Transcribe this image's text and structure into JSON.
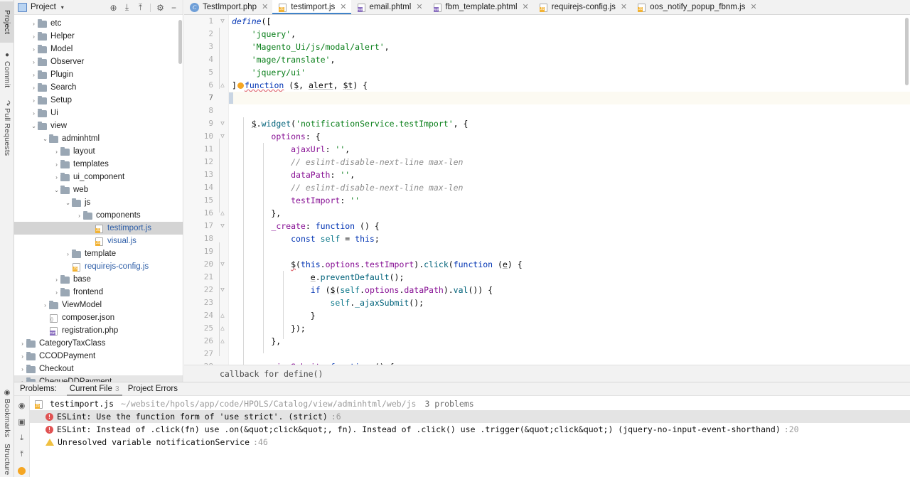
{
  "left_toolbar": {
    "top_items": [
      {
        "label": "Project",
        "icon": "project-icon",
        "active": true
      },
      {
        "label": "Commit",
        "icon": "commit-icon",
        "active": false
      },
      {
        "label": "Pull Requests",
        "icon": "pull-requests-icon",
        "active": false
      }
    ],
    "bottom_items": [
      {
        "label": "Bookmarks",
        "icon": "bookmarks-icon",
        "active": false
      },
      {
        "label": "Structure",
        "icon": "structure-icon",
        "active": false
      }
    ]
  },
  "project_panel": {
    "title": "Project",
    "caret": "▾",
    "tools": [
      {
        "name": "locate-icon",
        "glyph": "⊕"
      },
      {
        "name": "expand-all-icon",
        "glyph": "⤓"
      },
      {
        "name": "collapse-all-icon",
        "glyph": "⤒"
      },
      {
        "name": "settings-gear-icon",
        "glyph": "⚙"
      },
      {
        "name": "hide-panel-icon",
        "glyph": "−"
      }
    ],
    "tree": [
      {
        "label": "etc",
        "indent": 1,
        "arrow": "›",
        "icon": "folder",
        "selected": false
      },
      {
        "label": "Helper",
        "indent": 1,
        "arrow": "›",
        "icon": "folder",
        "selected": false
      },
      {
        "label": "Model",
        "indent": 1,
        "arrow": "›",
        "icon": "folder",
        "selected": false
      },
      {
        "label": "Observer",
        "indent": 1,
        "arrow": "›",
        "icon": "folder",
        "selected": false
      },
      {
        "label": "Plugin",
        "indent": 1,
        "arrow": "›",
        "icon": "folder",
        "selected": false
      },
      {
        "label": "Search",
        "indent": 1,
        "arrow": "›",
        "icon": "folder",
        "selected": false
      },
      {
        "label": "Setup",
        "indent": 1,
        "arrow": "›",
        "icon": "folder",
        "selected": false
      },
      {
        "label": "Ui",
        "indent": 1,
        "arrow": "›",
        "icon": "folder",
        "selected": false
      },
      {
        "label": "view",
        "indent": 1,
        "arrow": "⌄",
        "icon": "folder",
        "selected": false
      },
      {
        "label": "adminhtml",
        "indent": 2,
        "arrow": "⌄",
        "icon": "folder",
        "selected": false
      },
      {
        "label": "layout",
        "indent": 3,
        "arrow": "›",
        "icon": "folder",
        "selected": false
      },
      {
        "label": "templates",
        "indent": 3,
        "arrow": "›",
        "icon": "folder",
        "selected": false
      },
      {
        "label": "ui_component",
        "indent": 3,
        "arrow": "›",
        "icon": "folder",
        "selected": false
      },
      {
        "label": "web",
        "indent": 3,
        "arrow": "⌄",
        "icon": "folder",
        "selected": false
      },
      {
        "label": "js",
        "indent": 4,
        "arrow": "⌄",
        "icon": "folder",
        "selected": false
      },
      {
        "label": "components",
        "indent": 5,
        "arrow": "›",
        "icon": "folder",
        "selected": false
      },
      {
        "label": "testimport.js",
        "indent": 6,
        "arrow": "",
        "icon": "js",
        "selected": true
      },
      {
        "label": "visual.js",
        "indent": 6,
        "arrow": "",
        "icon": "js",
        "selected": false
      },
      {
        "label": "template",
        "indent": 4,
        "arrow": "›",
        "icon": "folder",
        "selected": false
      },
      {
        "label": "requirejs-config.js",
        "indent": 4,
        "arrow": "",
        "icon": "js",
        "selected": false
      },
      {
        "label": "base",
        "indent": 3,
        "arrow": "›",
        "icon": "folder",
        "selected": false
      },
      {
        "label": "frontend",
        "indent": 3,
        "arrow": "›",
        "icon": "folder",
        "selected": false
      },
      {
        "label": "ViewModel",
        "indent": 2,
        "arrow": "›",
        "icon": "folder",
        "selected": false
      },
      {
        "label": "composer.json",
        "indent": 2,
        "arrow": "",
        "icon": "json",
        "selected": false
      },
      {
        "label": "registration.php",
        "indent": 2,
        "arrow": "",
        "icon": "php",
        "selected": false
      },
      {
        "label": "CategoryTaxClass",
        "indent": 0,
        "arrow": "›",
        "icon": "folder",
        "selected": false
      },
      {
        "label": "CCODPayment",
        "indent": 0,
        "arrow": "›",
        "icon": "folder",
        "selected": false
      },
      {
        "label": "Checkout",
        "indent": 0,
        "arrow": "›",
        "icon": "folder",
        "selected": false
      },
      {
        "label": "ChequeDDPayment",
        "indent": 0,
        "arrow": "›",
        "icon": "folder",
        "selected": false
      }
    ]
  },
  "tabs": [
    {
      "label": "TestImport.php",
      "icon": "php-class-icon",
      "active": false
    },
    {
      "label": "testimport.js",
      "icon": "js-file-icon",
      "active": true
    },
    {
      "label": "email.phtml",
      "icon": "phtml-file-icon",
      "active": false
    },
    {
      "label": "fbm_template.phtml",
      "icon": "phtml-file-icon",
      "active": false
    },
    {
      "label": "requirejs-config.js",
      "icon": "js-file-icon",
      "active": false
    },
    {
      "label": "oos_notify_popup_fbnm.js",
      "icon": "js-file-icon",
      "active": false
    }
  ],
  "editor": {
    "hint": "callback for define()",
    "lines": [
      {
        "n": 1,
        "fold": "▽",
        "current": false,
        "tokens": [
          {
            "t": "define",
            "c": "kwi"
          },
          {
            "t": "([",
            "c": "plain"
          }
        ]
      },
      {
        "n": 2,
        "fold": "",
        "current": false,
        "tokens": [
          {
            "t": "    ",
            "c": "plain"
          },
          {
            "t": "'jquery'",
            "c": "str"
          },
          {
            "t": ",",
            "c": "plain"
          }
        ]
      },
      {
        "n": 3,
        "fold": "",
        "current": false,
        "tokens": [
          {
            "t": "    ",
            "c": "plain"
          },
          {
            "t": "'Magento_Ui/js/modal/alert'",
            "c": "str"
          },
          {
            "t": ",",
            "c": "plain"
          }
        ]
      },
      {
        "n": 4,
        "fold": "",
        "current": false,
        "tokens": [
          {
            "t": "    ",
            "c": "plain"
          },
          {
            "t": "'mage/translate'",
            "c": "str"
          },
          {
            "t": ",",
            "c": "plain"
          }
        ]
      },
      {
        "n": 5,
        "fold": "",
        "current": false,
        "tokens": [
          {
            "t": "    ",
            "c": "plain"
          },
          {
            "t": "'jquery/ui'",
            "c": "str"
          }
        ]
      },
      {
        "n": 6,
        "fold": "△",
        "current": false,
        "tokens": [
          {
            "t": "]",
            "c": "plain"
          },
          {
            "t": "BULB",
            "c": "bulb"
          },
          {
            "t": "function",
            "c": "kw uline wavy"
          },
          {
            "t": " (",
            "c": "plain"
          },
          {
            "t": "$",
            "c": "plain uline"
          },
          {
            "t": ", ",
            "c": "plain"
          },
          {
            "t": "alert",
            "c": "plain uline"
          },
          {
            "t": ", ",
            "c": "plain"
          },
          {
            "t": "$t",
            "c": "plain uline"
          },
          {
            "t": ") {",
            "c": "plain"
          }
        ]
      },
      {
        "n": 7,
        "fold": "",
        "current": true,
        "tokens": [
          {
            "t": "CARET",
            "c": "caret"
          }
        ]
      },
      {
        "n": 8,
        "fold": "",
        "current": false,
        "tokens": []
      },
      {
        "n": 9,
        "fold": "▽",
        "current": false,
        "tokens": [
          {
            "t": "    ",
            "c": "plain"
          },
          {
            "t": "$",
            "c": "plain uline"
          },
          {
            "t": ".",
            "c": "plain"
          },
          {
            "t": "widget",
            "c": "fn"
          },
          {
            "t": "(",
            "c": "plain"
          },
          {
            "t": "'notificationService.testImport'",
            "c": "str"
          },
          {
            "t": ", {",
            "c": "plain"
          }
        ]
      },
      {
        "n": 10,
        "fold": "▽",
        "current": false,
        "tokens": [
          {
            "t": "        ",
            "c": "plain"
          },
          {
            "t": "options",
            "c": "prop"
          },
          {
            "t": ": {",
            "c": "plain"
          }
        ]
      },
      {
        "n": 11,
        "fold": "",
        "current": false,
        "tokens": [
          {
            "t": "            ",
            "c": "plain"
          },
          {
            "t": "ajaxUrl",
            "c": "prop"
          },
          {
            "t": ": ",
            "c": "plain"
          },
          {
            "t": "''",
            "c": "str"
          },
          {
            "t": ",",
            "c": "plain"
          }
        ]
      },
      {
        "n": 12,
        "fold": "",
        "current": false,
        "tokens": [
          {
            "t": "            ",
            "c": "plain"
          },
          {
            "t": "// eslint-disable-next-line max-len",
            "c": "cmt"
          }
        ]
      },
      {
        "n": 13,
        "fold": "",
        "current": false,
        "tokens": [
          {
            "t": "            ",
            "c": "plain"
          },
          {
            "t": "dataPath",
            "c": "prop"
          },
          {
            "t": ": ",
            "c": "plain"
          },
          {
            "t": "''",
            "c": "str"
          },
          {
            "t": ",",
            "c": "plain"
          }
        ]
      },
      {
        "n": 14,
        "fold": "",
        "current": false,
        "tokens": [
          {
            "t": "            ",
            "c": "plain"
          },
          {
            "t": "// eslint-disable-next-line max-len",
            "c": "cmt"
          }
        ]
      },
      {
        "n": 15,
        "fold": "",
        "current": false,
        "tokens": [
          {
            "t": "            ",
            "c": "plain"
          },
          {
            "t": "testImport",
            "c": "prop"
          },
          {
            "t": ": ",
            "c": "plain"
          },
          {
            "t": "''",
            "c": "str"
          }
        ]
      },
      {
        "n": 16,
        "fold": "△",
        "current": false,
        "tokens": [
          {
            "t": "        },",
            "c": "plain"
          }
        ]
      },
      {
        "n": 17,
        "fold": "▽",
        "current": false,
        "tokens": [
          {
            "t": "        ",
            "c": "plain"
          },
          {
            "t": "_create",
            "c": "prop"
          },
          {
            "t": ": ",
            "c": "plain"
          },
          {
            "t": "function",
            "c": "kw"
          },
          {
            "t": " () {",
            "c": "plain"
          }
        ]
      },
      {
        "n": 18,
        "fold": "",
        "current": false,
        "tokens": [
          {
            "t": "            ",
            "c": "plain"
          },
          {
            "t": "const",
            "c": "kw"
          },
          {
            "t": " ",
            "c": "plain"
          },
          {
            "t": "self",
            "c": "local"
          },
          {
            "t": " = ",
            "c": "plain"
          },
          {
            "t": "this",
            "c": "kw"
          },
          {
            "t": ";",
            "c": "plain"
          }
        ]
      },
      {
        "n": 19,
        "fold": "",
        "current": false,
        "tokens": []
      },
      {
        "n": 20,
        "fold": "▽",
        "current": false,
        "tokens": [
          {
            "t": "            ",
            "c": "plain"
          },
          {
            "t": "$",
            "c": "plain wavy"
          },
          {
            "t": "(",
            "c": "plain"
          },
          {
            "t": "this",
            "c": "kw"
          },
          {
            "t": ".",
            "c": "plain"
          },
          {
            "t": "options",
            "c": "prop"
          },
          {
            "t": ".",
            "c": "plain"
          },
          {
            "t": "testImport",
            "c": "prop"
          },
          {
            "t": ").",
            "c": "plain"
          },
          {
            "t": "click",
            "c": "fn"
          },
          {
            "t": "(",
            "c": "plain"
          },
          {
            "t": "function",
            "c": "kw"
          },
          {
            "t": " (",
            "c": "plain"
          },
          {
            "t": "e",
            "c": "plain uline"
          },
          {
            "t": ") {",
            "c": "plain"
          }
        ]
      },
      {
        "n": 21,
        "fold": "",
        "current": false,
        "tokens": [
          {
            "t": "                ",
            "c": "plain"
          },
          {
            "t": "e",
            "c": "plain uline"
          },
          {
            "t": ".",
            "c": "plain"
          },
          {
            "t": "preventDefault",
            "c": "fn"
          },
          {
            "t": "();",
            "c": "plain"
          }
        ]
      },
      {
        "n": 22,
        "fold": "▽",
        "current": false,
        "tokens": [
          {
            "t": "                ",
            "c": "plain"
          },
          {
            "t": "if",
            "c": "kw"
          },
          {
            "t": " (",
            "c": "plain"
          },
          {
            "t": "$",
            "c": "plain uline"
          },
          {
            "t": "(",
            "c": "plain"
          },
          {
            "t": "self",
            "c": "local"
          },
          {
            "t": ".",
            "c": "plain"
          },
          {
            "t": "options",
            "c": "prop"
          },
          {
            "t": ".",
            "c": "plain"
          },
          {
            "t": "dataPath",
            "c": "prop"
          },
          {
            "t": ").",
            "c": "plain"
          },
          {
            "t": "val",
            "c": "fn"
          },
          {
            "t": "()) {",
            "c": "plain"
          }
        ]
      },
      {
        "n": 23,
        "fold": "",
        "current": false,
        "tokens": [
          {
            "t": "                    ",
            "c": "plain"
          },
          {
            "t": "self",
            "c": "local"
          },
          {
            "t": ".",
            "c": "plain"
          },
          {
            "t": "_ajaxSubmit",
            "c": "fn"
          },
          {
            "t": "();",
            "c": "plain"
          }
        ]
      },
      {
        "n": 24,
        "fold": "△",
        "current": false,
        "tokens": [
          {
            "t": "                }",
            "c": "plain"
          }
        ]
      },
      {
        "n": 25,
        "fold": "△",
        "current": false,
        "tokens": [
          {
            "t": "            });",
            "c": "plain"
          }
        ]
      },
      {
        "n": 26,
        "fold": "△",
        "current": false,
        "tokens": [
          {
            "t": "        },",
            "c": "plain"
          }
        ]
      },
      {
        "n": 27,
        "fold": "",
        "current": false,
        "tokens": []
      },
      {
        "n": 28,
        "fold": "▽",
        "current": false,
        "tokens": [
          {
            "t": "        ",
            "c": "plain"
          },
          {
            "t": "ajaxSubmit",
            "c": "prop"
          },
          {
            "t": ": ",
            "c": "plain"
          },
          {
            "t": "function",
            "c": "kw"
          },
          {
            "t": " () {",
            "c": "plain"
          }
        ]
      }
    ]
  },
  "problems": {
    "label": "Problems:",
    "tabs": [
      {
        "label": "Current File",
        "count": "3",
        "active": true
      },
      {
        "label": "Project Errors",
        "count": "",
        "active": false
      }
    ],
    "side_icons": [
      {
        "name": "inspection-eye-icon",
        "glyph": "◉"
      },
      {
        "name": "preview-panel-icon",
        "glyph": "▣"
      },
      {
        "name": "expand-all-icon",
        "glyph": "⤓"
      },
      {
        "name": "collapse-all-icon",
        "glyph": "⤒"
      },
      {
        "name": "quick-fix-bulb-icon",
        "glyph": ""
      }
    ],
    "file": {
      "name": "testimport.js",
      "path": "~/website/hpols/app/code/HPOLS/Catalog/view/adminhtml/web/js",
      "count": "3 problems"
    },
    "items": [
      {
        "severity": "error",
        "message": "ESLint: Use the function form of 'use strict'. (strict)",
        "line": ":6",
        "selected": true
      },
      {
        "severity": "error",
        "message": "ESLint: Instead of .click(fn) use .on(&quot;click&quot;, fn). Instead of .click() use .trigger(&quot;click&quot;) (jquery-no-input-event-shorthand)",
        "line": ":20",
        "selected": false
      },
      {
        "severity": "warning",
        "message": "Unresolved variable notificationService",
        "line": ":46",
        "selected": false
      }
    ]
  }
}
